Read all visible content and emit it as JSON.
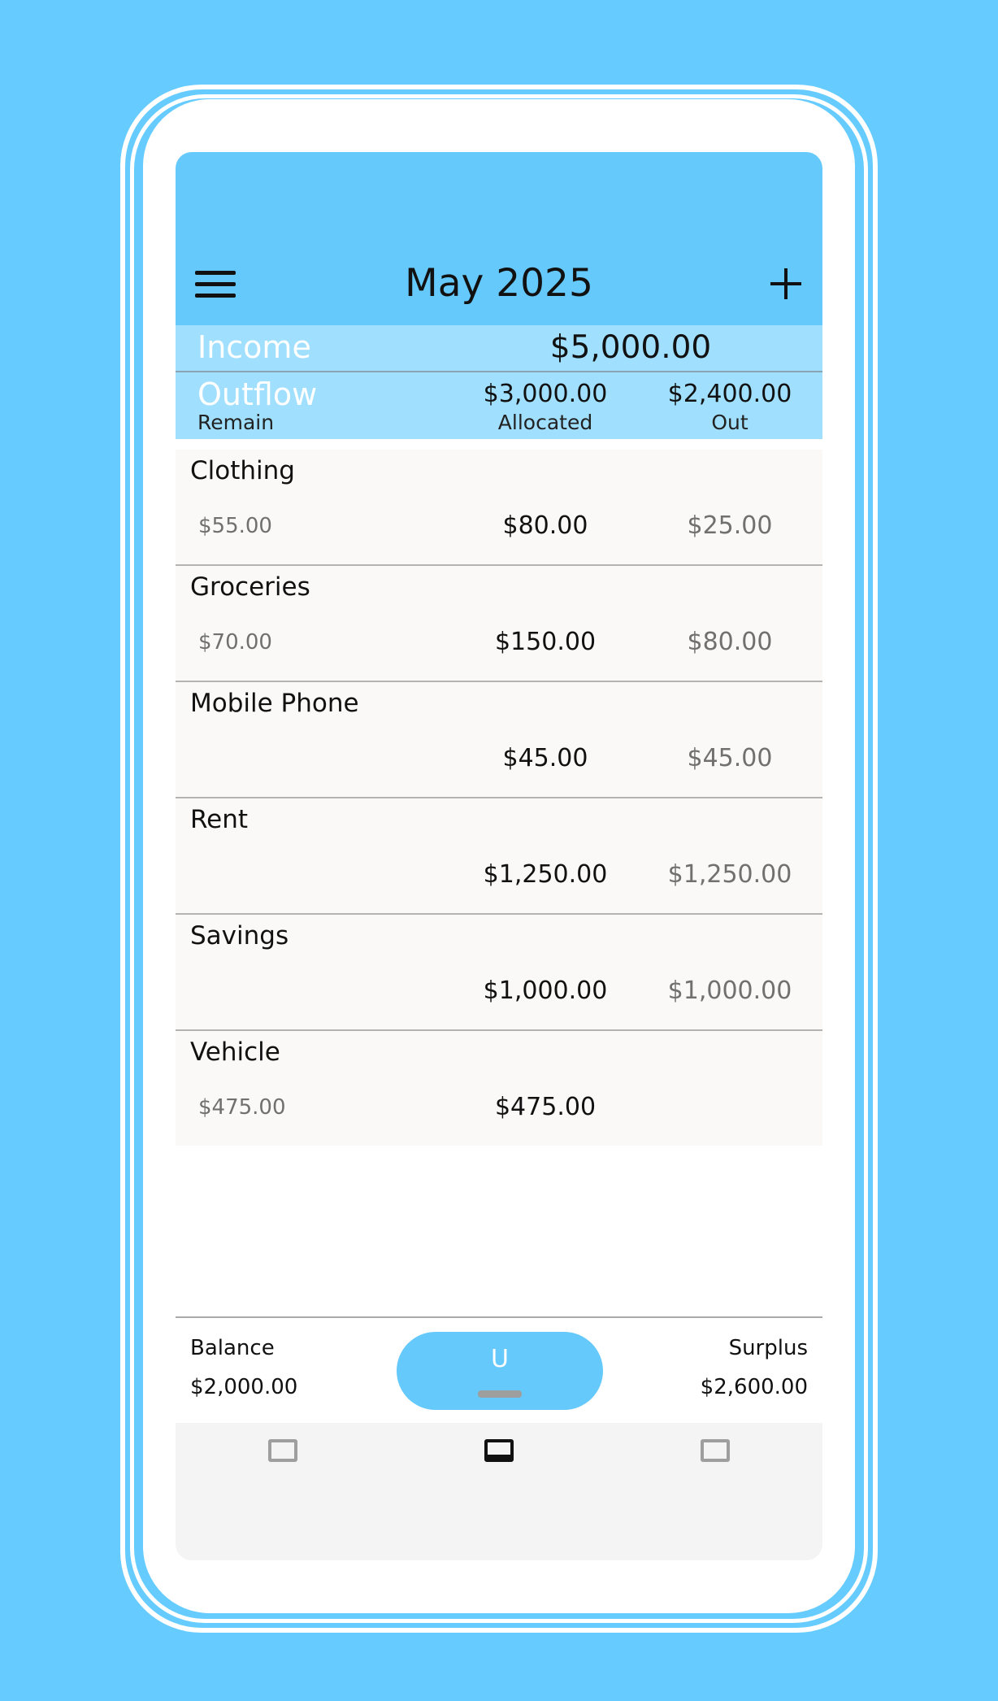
{
  "header": {
    "title": "May 2025",
    "menu_icon": "menu-icon",
    "add_icon": "plus-icon"
  },
  "summary": {
    "income_label": "Income",
    "income_value": "$5,000.00",
    "outflow_label": "Outflow",
    "outflow_allocated": "$3,000.00",
    "outflow_out": "$2,400.00",
    "columns": {
      "remain": "Remain",
      "allocated": "Allocated",
      "out": "Out"
    }
  },
  "categories": [
    {
      "name": "Clothing",
      "remain": "$55.00",
      "allocated": "$80.00",
      "out": "$25.00"
    },
    {
      "name": "Groceries",
      "remain": "$70.00",
      "allocated": "$150.00",
      "out": "$80.00"
    },
    {
      "name": "Mobile Phone",
      "remain": "",
      "allocated": "$45.00",
      "out": "$45.00"
    },
    {
      "name": "Rent",
      "remain": "",
      "allocated": "$1,250.00",
      "out": "$1,250.00"
    },
    {
      "name": "Savings",
      "remain": "",
      "allocated": "$1,000.00",
      "out": "$1,000.00"
    },
    {
      "name": "Vehicle",
      "remain": "$475.00",
      "allocated": "$475.00",
      "out": ""
    }
  ],
  "footer": {
    "balance_label": "Balance",
    "balance_value": "$2,000.00",
    "surplus_label": "Surplus",
    "surplus_value": "$2,600.00",
    "center_button_label": "U"
  },
  "nav": {
    "tabs": [
      {
        "icon": "tab-icon",
        "active": false
      },
      {
        "icon": "tab-icon",
        "active": true
      },
      {
        "icon": "tab-icon",
        "active": false
      }
    ]
  },
  "colors": {
    "background": "#66ccff",
    "app_bar": "#66c9fb",
    "summary_panel": "#a0dffe",
    "row_background": "#faf9f8",
    "nav_background": "#f4f4f4"
  }
}
